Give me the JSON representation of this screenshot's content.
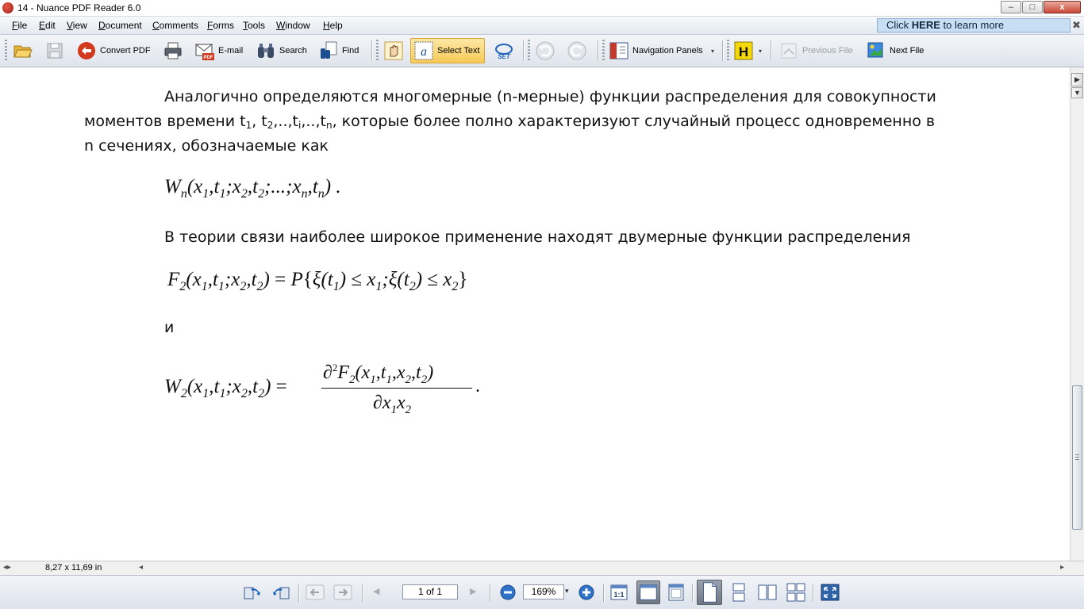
{
  "window": {
    "title": "14 - Nuance PDF Reader 6.0",
    "min_glyph": "–",
    "max_glyph": "□",
    "close_glyph": "x"
  },
  "menu": {
    "items": [
      {
        "accel": "F",
        "rest": "ile"
      },
      {
        "accel": "E",
        "rest": "dit"
      },
      {
        "accel": "V",
        "rest": "iew"
      },
      {
        "accel": "D",
        "rest": "ocument"
      },
      {
        "accel": "C",
        "rest": "omments"
      },
      {
        "accel": "F",
        "rest": "orms"
      },
      {
        "accel": "T",
        "rest": "ools"
      },
      {
        "accel": "W",
        "rest": "indow"
      },
      {
        "accel": "H",
        "rest": "elp"
      }
    ]
  },
  "promo": {
    "prefix": "Click ",
    "bold": "HERE",
    "suffix": " to learn more",
    "close_glyph": "✖"
  },
  "toolbar": {
    "convert_pdf": "Convert PDF",
    "email": "E-mail",
    "search": "Search",
    "find": "Find",
    "select_text": "Select Text",
    "navigation_panels": "Navigation Panels",
    "previous_file": "Previous File",
    "next_file": "Next File",
    "dropdown_glyph": "▾",
    "pdf_badge": "PDF",
    "set_badge": "SET",
    "highlight_badge": "H"
  },
  "document": {
    "para1_line1": "Аналогично определяются многомерные (n-мерные) функции распределения     для     совокупности",
    "para1_line2": {
      "prefix": "моментов    времени t",
      "s1": "1",
      "c1": ", t",
      "s2": "2",
      "c2": ",..,t",
      "s3": "i",
      "c3": ",..,t",
      "s4": "n",
      "suffix": ", которые   более полно характеризуют случайный процесс одновременно в"
    },
    "para1_line3": "n сечениях, обозначаемые как",
    "para2": "В теории связи наиболее широкое применение находят двумерные функции распределения",
    "conj": "и"
  },
  "status": {
    "page_size": "8,27 x 11,69 in",
    "left_arrow": "◂",
    "right_arrow": "▸",
    "split_glyph": "◂▸"
  },
  "navigation": {
    "page_value": "1 of 1",
    "zoom_value": "169%",
    "zoom_dropdown": "▾",
    "prev_glyph": "◀",
    "next_glyph": "▶",
    "one_to_one": "1:1"
  },
  "scrollbar": {
    "up_glyph": "▶",
    "down_glyph": "▼"
  },
  "colors": {
    "accent_blue": "#1e63b8",
    "select_highlight": "#f7c955",
    "convert_red": "#d23a1e"
  }
}
